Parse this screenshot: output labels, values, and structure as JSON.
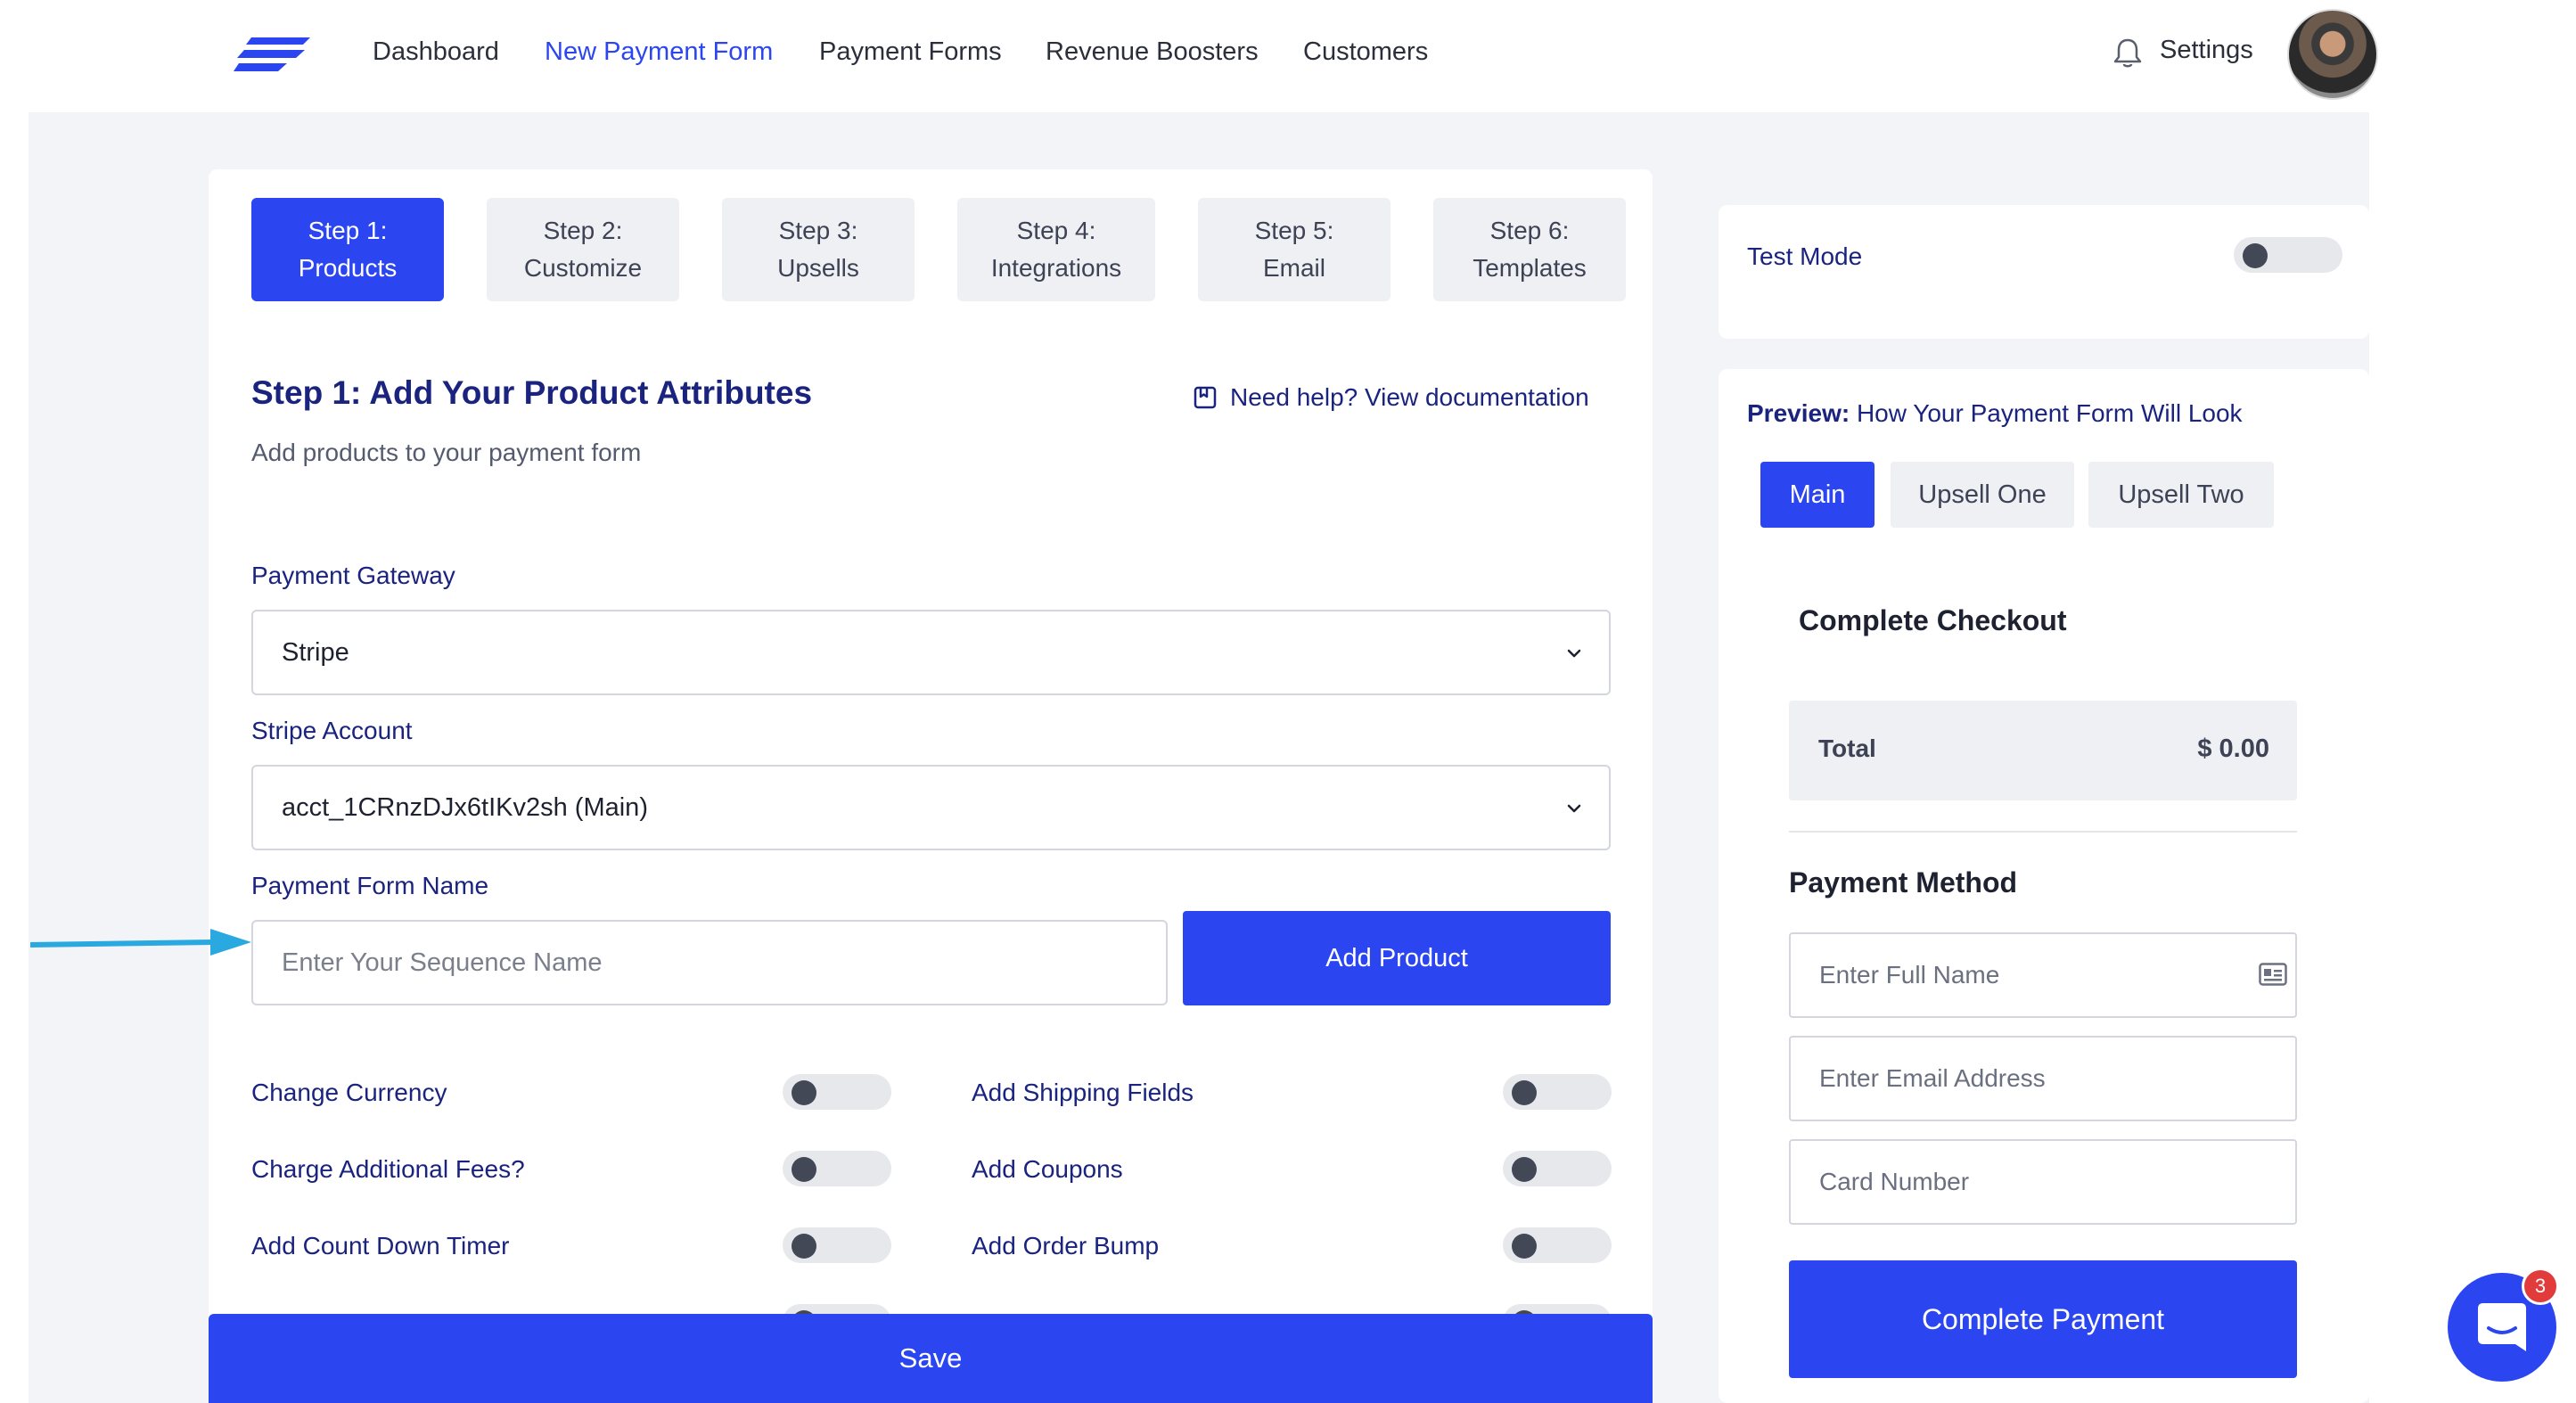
{
  "nav": {
    "items": [
      "Dashboard",
      "New Payment Form",
      "Payment Forms",
      "Revenue Boosters",
      "Customers"
    ],
    "active_index": 1,
    "settings_label": "Settings",
    "icons": {
      "logo": "brand-logo-icon",
      "bell": "bell-icon",
      "avatar": "user-avatar"
    }
  },
  "steps": [
    {
      "line1": "Step 1:",
      "line2": "Products"
    },
    {
      "line1": "Step 2:",
      "line2": "Customize"
    },
    {
      "line1": "Step 3:",
      "line2": "Upsells"
    },
    {
      "line1": "Step 4:",
      "line2": "Integrations"
    },
    {
      "line1": "Step 5:",
      "line2": "Email"
    },
    {
      "line1": "Step 6:",
      "line2": "Templates"
    }
  ],
  "main": {
    "title": "Step 1: Add Your Product Attributes",
    "subtitle": "Add products to your payment form",
    "help_link": "Need help? View documentation",
    "gateway": {
      "label": "Payment Gateway",
      "value": "Stripe"
    },
    "account": {
      "label": "Stripe Account",
      "value": "acct_1CRnzDJx6tIKv2sh (Main)"
    },
    "form_name": {
      "label": "Payment Form Name",
      "placeholder": "Enter Your Sequence Name",
      "value": ""
    },
    "add_product_label": "Add Product",
    "options_left": [
      "Change Currency",
      "Charge Additional Fees?",
      "Add Count Down Timer"
    ],
    "options_right": [
      "Add Shipping Fields",
      "Add Coupons",
      "Add Order Bump"
    ],
    "toggles_on": false,
    "save_label": "Save"
  },
  "sidebar": {
    "test_mode_label": "Test Mode",
    "test_mode_on": false,
    "preview_bold": "Preview:",
    "preview_rest": " How Your Payment Form Will Look",
    "preview_tabs": [
      "Main",
      "Upsell One",
      "Upsell Two"
    ],
    "preview_active_index": 0,
    "checkout_title": "Complete Checkout",
    "total_label": "Total",
    "total_value": "$ 0.00",
    "payment_method_title": "Payment Method",
    "inputs": [
      "Enter Full Name",
      "Enter Email Address",
      "Card Number"
    ],
    "complete_label": "Complete Payment"
  },
  "chat": {
    "badge_count": "3"
  },
  "colors": {
    "accent": "#2b46f0",
    "navy": "#1a237e",
    "badge": "#e23b3b",
    "arrow": "#2aa8e0"
  }
}
